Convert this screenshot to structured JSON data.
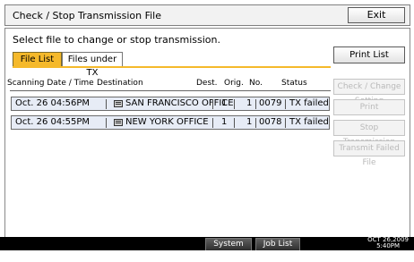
{
  "title": "Check / Stop Transmission File",
  "exit_label": "Exit",
  "instruction": "Select file to change or stop transmission.",
  "tabs": [
    {
      "label": "File List"
    },
    {
      "label": "Files under TX"
    }
  ],
  "table": {
    "headers": [
      "Scanning Date / Time",
      "Destination",
      "Dest.",
      "Orig.",
      "No.",
      "Status"
    ],
    "rows": [
      {
        "date": "Oct. 26 04:56PM",
        "destination": "SAN FRANCISCO OFFICE",
        "dest": "1",
        "orig": "1",
        "no": "0079",
        "status": "TX failed"
      },
      {
        "date": "Oct. 26 04:55PM",
        "destination": "NEW YORK OFFICE",
        "dest": "1",
        "orig": "1",
        "no": "0078",
        "status": "TX failed"
      }
    ]
  },
  "side_buttons": [
    {
      "label": "Print List",
      "enabled": true
    },
    {
      "label": "Check / Change Setting",
      "enabled": false
    },
    {
      "label": "Print",
      "enabled": false
    },
    {
      "label": "Stop Transmission",
      "enabled": false
    },
    {
      "label": "Transmit Failed File",
      "enabled": false
    }
  ],
  "bottom": {
    "system_status": "System Status",
    "job_list": "Job List",
    "date": "OCT  26,2009",
    "time": "5:40PM"
  },
  "colors": {
    "active_tab": "#f5b92b",
    "row_background": "#e7ecf6",
    "disabled_text": "#b9b9b9"
  },
  "icons": [
    "fax-destination-icon"
  ]
}
